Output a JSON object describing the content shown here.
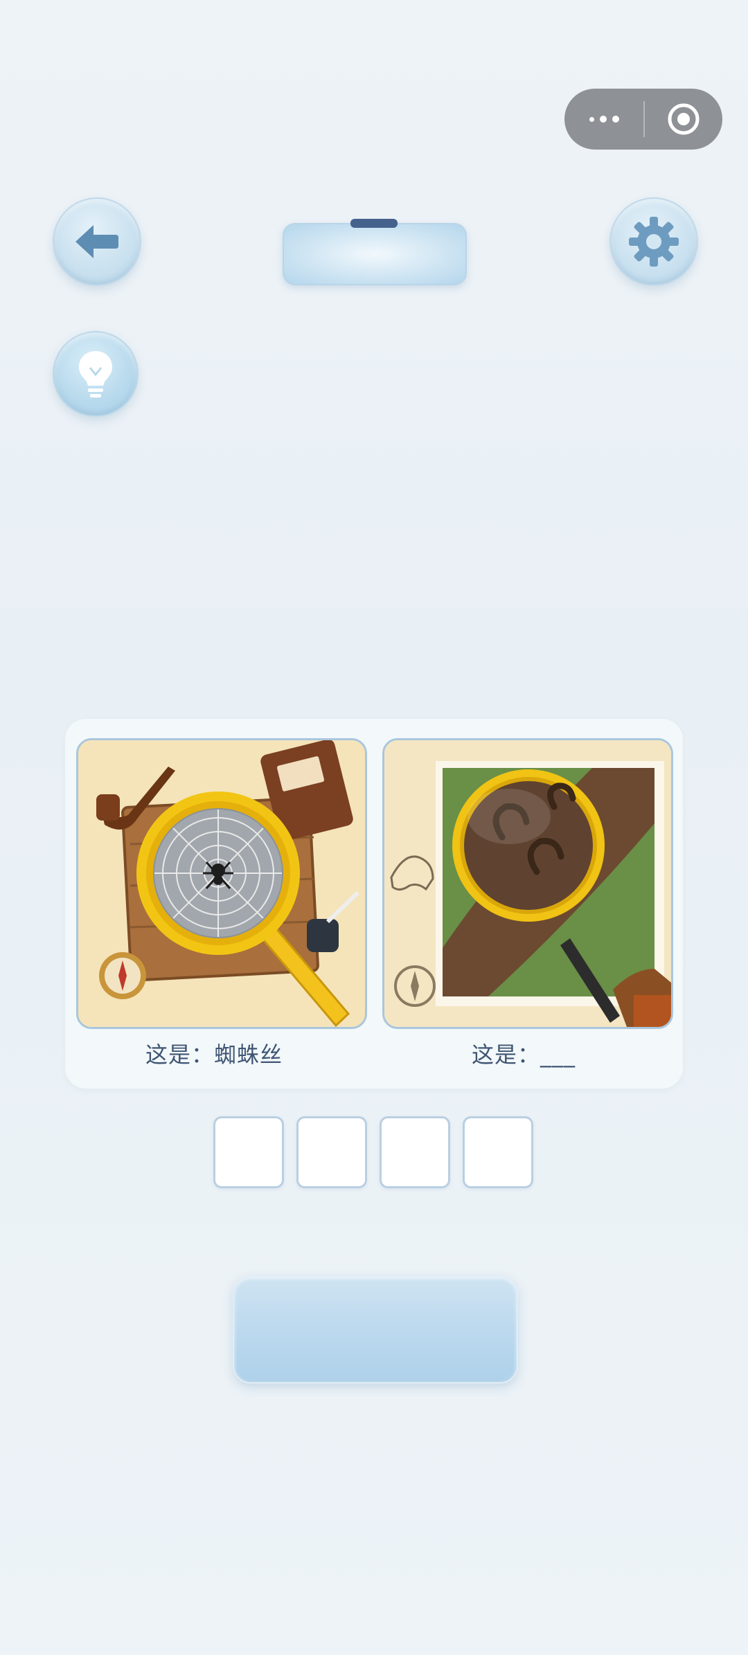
{
  "capsule": {
    "more_icon": "more-dots-icon",
    "close_icon": "target-close-icon"
  },
  "toolbar": {
    "back_icon": "arrow-left-icon",
    "settings_icon": "gear-icon",
    "hint_icon": "lightbulb-icon"
  },
  "puzzle": {
    "panels": [
      {
        "image": "magnifying-glass-spider-web",
        "caption": "这是：蜘蛛丝"
      },
      {
        "image": "magnifying-glass-hoofprints",
        "caption": "这是：___"
      }
    ],
    "answer_slots": [
      "",
      "",
      "",
      ""
    ]
  },
  "colors": {
    "accent": "#45628c",
    "button": "#bcd9ee",
    "caption_text": "#3f5573"
  }
}
